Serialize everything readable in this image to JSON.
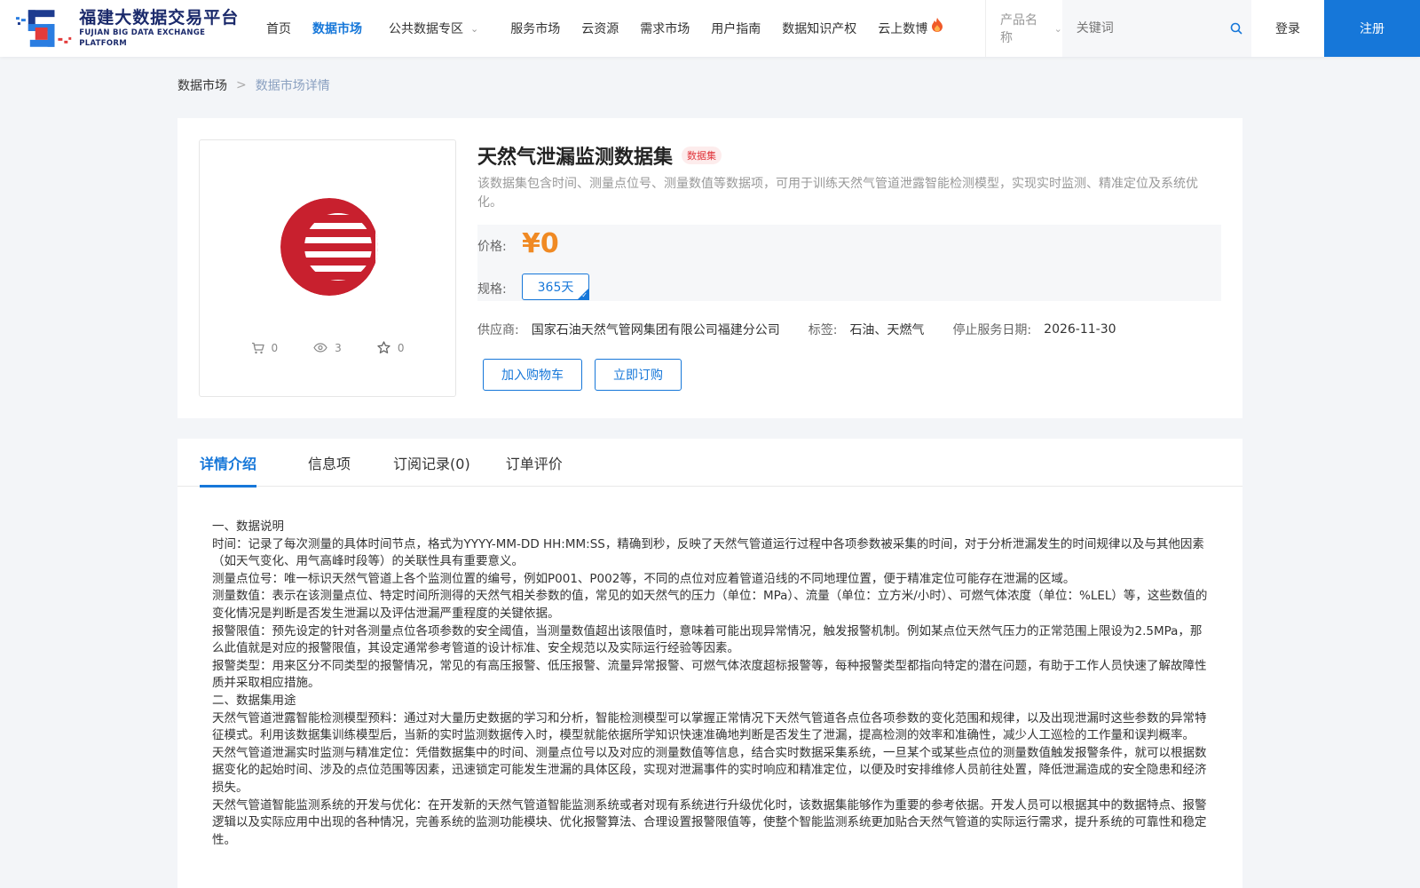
{
  "header": {
    "logo_cn": "福建大数据交易平台",
    "logo_en": "FUJIAN BIG DATA EXCHANGE  PLATFORM",
    "nav": [
      {
        "label": "首页",
        "active": false
      },
      {
        "label": "数据市场",
        "active": true
      },
      {
        "label": "公共数据专区",
        "active": false,
        "dropdown": true
      },
      {
        "label": "服务市场",
        "active": false
      },
      {
        "label": "云资源",
        "active": false
      },
      {
        "label": "需求市场",
        "active": false
      },
      {
        "label": "用户指南",
        "active": false
      },
      {
        "label": "数据知识产权",
        "active": false
      },
      {
        "label": "云上数博",
        "active": false,
        "hot": true
      }
    ],
    "search_category": "产品名称",
    "search_placeholder": "关键词",
    "login_label": "登录",
    "register_label": "注册"
  },
  "breadcrumb": {
    "home": "数据市场",
    "sep": ">",
    "current": "数据市场详情"
  },
  "product": {
    "title": "天然气泄漏监测数据集",
    "badge": "数据集",
    "description": "该数据集包含时间、测量点位号、测量数值等数据项，可用于训练天然气管道泄露智能检测模型，实现实时监测、精准定位及系统优化。",
    "price_label": "价格:",
    "price": "¥0",
    "spec_label": "规格:",
    "spec_value": "365天",
    "stats": {
      "cart": "0",
      "views": "3",
      "favorites": "0"
    },
    "supplier_label": "供应商:",
    "supplier": "国家石油天然气管网集团有限公司福建分公司",
    "tags_label": "标签:",
    "tags": "石油、天燃气",
    "stop_label": "停止服务日期:",
    "stop_date": "2026-11-30",
    "add_cart_label": "加入购物车",
    "buy_label": "立即订购"
  },
  "tabs": [
    {
      "label": "详情介绍",
      "active": true
    },
    {
      "label": "信息项",
      "active": false
    },
    {
      "label": "订阅记录(0)",
      "active": false
    },
    {
      "label": "订单评价",
      "active": false
    }
  ],
  "detail_paragraphs": [
    "一、数据说明",
    "时间：记录了每次测量的具体时间节点，格式为YYYY-MM-DD HH:MM:SS，精确到秒，反映了天然气管道运行过程中各项参数被采集的时间，对于分析泄漏发生的时间规律以及与其他因素（如天气变化、用气高峰时段等）的关联性具有重要意义。",
    "测量点位号：唯一标识天然气管道上各个监测位置的编号，例如P001、P002等，不同的点位对应着管道沿线的不同地理位置，便于精准定位可能存在泄漏的区域。",
    "测量数值：表示在该测量点位、特定时间所测得的天然气相关参数的值，常见的如天然气的压力（单位：MPa）、流量（单位：立方米/小时）、可燃气体浓度（单位：%LEL）等，这些数值的变化情况是判断是否发生泄漏以及评估泄漏严重程度的关键依据。",
    "报警限值：预先设定的针对各测量点位各项参数的安全阈值，当测量数值超出该限值时，意味着可能出现异常情况，触发报警机制。例如某点位天然气压力的正常范围上限设为2.5MPa，那么此值就是对应的报警限值，其设定通常参考管道的设计标准、安全规范以及实际运行经验等因素。",
    "报警类型：用来区分不同类型的报警情况，常见的有高压报警、低压报警、流量异常报警、可燃气体浓度超标报警等，每种报警类型都指向特定的潜在问题，有助于工作人员快速了解故障性质并采取相应措施。",
    "二、数据集用途",
    "天然气管道泄露智能检测模型预料：通过对大量历史数据的学习和分析，智能检测模型可以掌握正常情况下天然气管道各点位各项参数的变化范围和规律，以及出现泄漏时这些参数的异常特征模式。利用该数据集训练模型后，当新的实时监测数据传入时，模型就能依据所学知识快速准确地判断是否发生了泄漏，提高检测的效率和准确性，减少人工巡检的工作量和误判概率。",
    "天然气管道泄漏实时监测与精准定位：凭借数据集中的时间、测量点位号以及对应的测量数值等信息，结合实时数据采集系统，一旦某个或某些点位的测量数值触发报警条件，就可以根据数据变化的起始时间、涉及的点位范围等因素，迅速锁定可能发生泄漏的具体区段，实现对泄漏事件的实时响应和精准定位，以便及时安排维修人员前往处置，降低泄漏造成的安全隐患和经济损失。",
    "天然气管道智能监测系统的开发与优化：在开发新的天然气管道智能监测系统或者对现有系统进行升级优化时，该数据集能够作为重要的参考依据。开发人员可以根据其中的数据特点、报警逻辑以及实际应用中出现的各种情况，完善系统的监测功能模块、优化报警算法、合理设置报警限值等，使整个智能监测系统更加贴合天然气管道的实际运行需求，提升系统的可靠性和稳定性。"
  ],
  "colors": {
    "primary": "#1677d9",
    "price": "#f08a24",
    "badge_text": "#e0353b",
    "logo_red": "#c8202e"
  }
}
